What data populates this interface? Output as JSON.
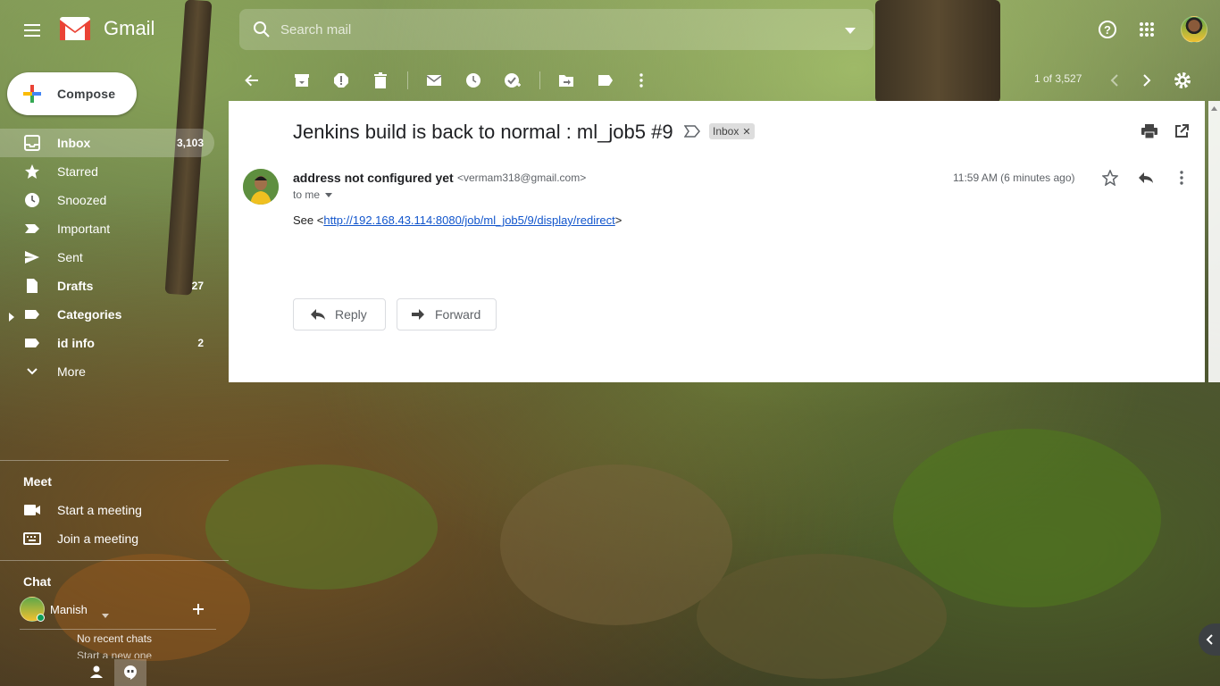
{
  "app": {
    "name": "Gmail"
  },
  "search": {
    "placeholder": "Search mail"
  },
  "toolbar": {
    "pager": "1 of 3,527"
  },
  "compose": {
    "label": "Compose"
  },
  "nav": [
    {
      "label": "Inbox",
      "count": "3,103",
      "icon": "inbox-icon",
      "active": true,
      "bold": true
    },
    {
      "label": "Starred",
      "count": "",
      "icon": "star-icon",
      "active": false,
      "bold": false
    },
    {
      "label": "Snoozed",
      "count": "",
      "icon": "clock-icon",
      "active": false,
      "bold": false
    },
    {
      "label": "Important",
      "count": "",
      "icon": "important-icon",
      "active": false,
      "bold": false
    },
    {
      "label": "Sent",
      "count": "",
      "icon": "send-icon",
      "active": false,
      "bold": false
    },
    {
      "label": "Drafts",
      "count": "27",
      "icon": "draft-icon",
      "active": false,
      "bold": true
    },
    {
      "label": "Categories",
      "count": "",
      "icon": "label-icon",
      "active": false,
      "bold": true
    },
    {
      "label": "id info",
      "count": "2",
      "icon": "label-icon",
      "active": false,
      "bold": true
    },
    {
      "label": "More",
      "count": "",
      "icon": "chevron-down-icon",
      "active": false,
      "bold": false
    }
  ],
  "meet": {
    "title": "Meet",
    "start": "Start a meeting",
    "join": "Join a meeting"
  },
  "chat": {
    "title": "Chat",
    "user": "Manish",
    "no_recent": "No recent chats",
    "start_new": "Start a new one"
  },
  "email": {
    "subject": "Jenkins build is back to normal : ml_job5 #9",
    "label_tag": "Inbox",
    "sender_name": "address not configured yet",
    "sender_email": "<vermam318@gmail.com>",
    "to": "to me",
    "time": "11:59 AM (6 minutes ago)",
    "body_prefix": "See <",
    "body_link": "http://192.168.43.114:8080/job/ml_job5/9/display/redirect",
    "body_suffix": ">",
    "reply_label": "Reply",
    "forward_label": "Forward"
  },
  "colors": {
    "brand_red": "#EA4335",
    "link": "#1155cc",
    "accent_blue": "#4285F4",
    "accent_green": "#34A853",
    "accent_yellow": "#FBBC05"
  }
}
